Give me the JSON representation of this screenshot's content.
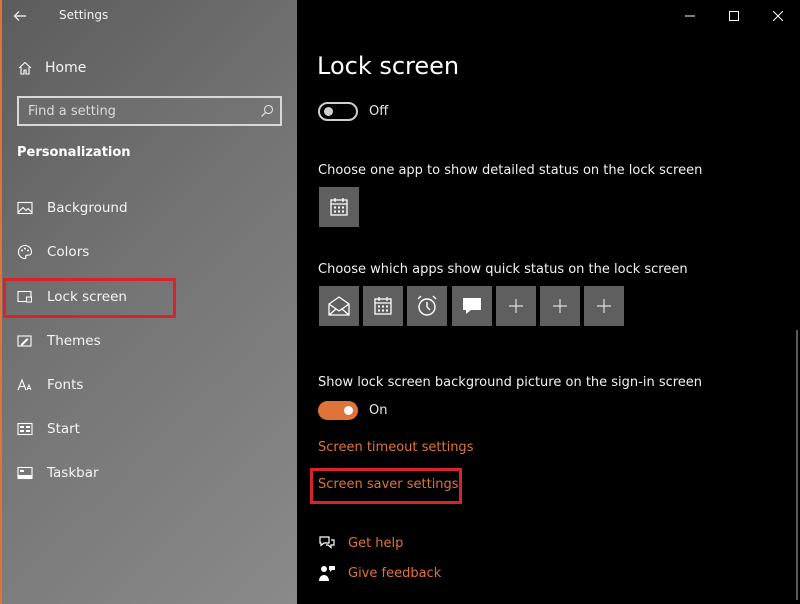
{
  "window": {
    "title": "Settings"
  },
  "sidebar": {
    "home_label": "Home",
    "search_placeholder": "Find a setting",
    "section_title": "Personalization",
    "items": [
      {
        "label": "Background",
        "icon": "picture-icon"
      },
      {
        "label": "Colors",
        "icon": "palette-icon"
      },
      {
        "label": "Lock screen",
        "icon": "lock-screen-icon"
      },
      {
        "label": "Themes",
        "icon": "brush-icon"
      },
      {
        "label": "Fonts",
        "icon": "fonts-icon"
      },
      {
        "label": "Start",
        "icon": "start-icon"
      },
      {
        "label": "Taskbar",
        "icon": "taskbar-icon"
      }
    ]
  },
  "main": {
    "page_title": "Lock screen",
    "top_toggle": {
      "state": "Off"
    },
    "detailed_status_label": "Choose one app to show detailed status on the lock screen",
    "detailed_status_apps": [
      "calendar-icon"
    ],
    "quick_status_label": "Choose which apps show quick status on the lock screen",
    "quick_status_apps": [
      "mail-icon",
      "calendar-icon",
      "alarm-icon",
      "messaging-icon",
      "add-icon",
      "add-icon",
      "add-icon"
    ],
    "signin_bg_label": "Show lock screen background picture on the sign-in screen",
    "signin_bg_toggle": {
      "state": "On"
    },
    "screen_timeout_link": "Screen timeout settings",
    "screen_saver_link": "Screen saver settings",
    "get_help_link": "Get help",
    "give_feedback_link": "Give feedback"
  },
  "colors": {
    "accent": "#e07338",
    "highlight": "#d8232a",
    "tile": "#5f5f5f"
  }
}
